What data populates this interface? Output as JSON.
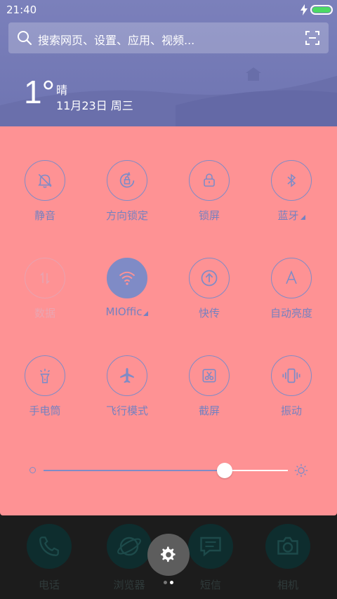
{
  "status_bar": {
    "time": "21:40",
    "icons": [
      "charging-bolt-icon",
      "battery-icon"
    ],
    "battery_color": "#4cd964"
  },
  "search": {
    "text": "搜索网页、设置、应用、视频...",
    "icons": [
      "search-icon",
      "scan-icon"
    ]
  },
  "weather": {
    "temperature": "1°",
    "condition": "晴",
    "date": "11月23日 周三"
  },
  "panel": {
    "background": "#fe9294",
    "accent": "#7f8bc6",
    "toggles": [
      {
        "label": "静音",
        "icon": "bell-off-icon",
        "active": false
      },
      {
        "label": "方向锁定",
        "icon": "rotation-lock-icon",
        "active": false
      },
      {
        "label": "锁屏",
        "icon": "lock-icon",
        "active": false
      },
      {
        "label": "蓝牙",
        "icon": "bluetooth-icon",
        "active": false,
        "expandable": true
      },
      {
        "label": "数据",
        "icon": "data-arrows-icon",
        "active": false,
        "disabled": true
      },
      {
        "label": "MIOffic",
        "icon": "wifi-icon",
        "active": true,
        "expandable": true
      },
      {
        "label": "快传",
        "icon": "upload-icon",
        "active": false
      },
      {
        "label": "自动亮度",
        "icon": "auto-brightness-icon",
        "active": false
      },
      {
        "label": "手电筒",
        "icon": "flashlight-icon",
        "active": false
      },
      {
        "label": "飞行模式",
        "icon": "airplane-icon",
        "active": false
      },
      {
        "label": "截屏",
        "icon": "screenshot-icon",
        "active": false
      },
      {
        "label": "振动",
        "icon": "vibrate-icon",
        "active": false
      }
    ],
    "brightness": {
      "level": 0.74
    }
  },
  "dock": [
    {
      "label": "电话",
      "icon": "phone-icon"
    },
    {
      "label": "浏览器",
      "icon": "browser-icon"
    },
    {
      "label": "短信",
      "icon": "message-icon"
    },
    {
      "label": "相机",
      "icon": "camera-icon"
    }
  ],
  "page_indicator": {
    "pages": 2,
    "current": 2
  },
  "settings_button": {
    "icon": "gear-icon"
  }
}
